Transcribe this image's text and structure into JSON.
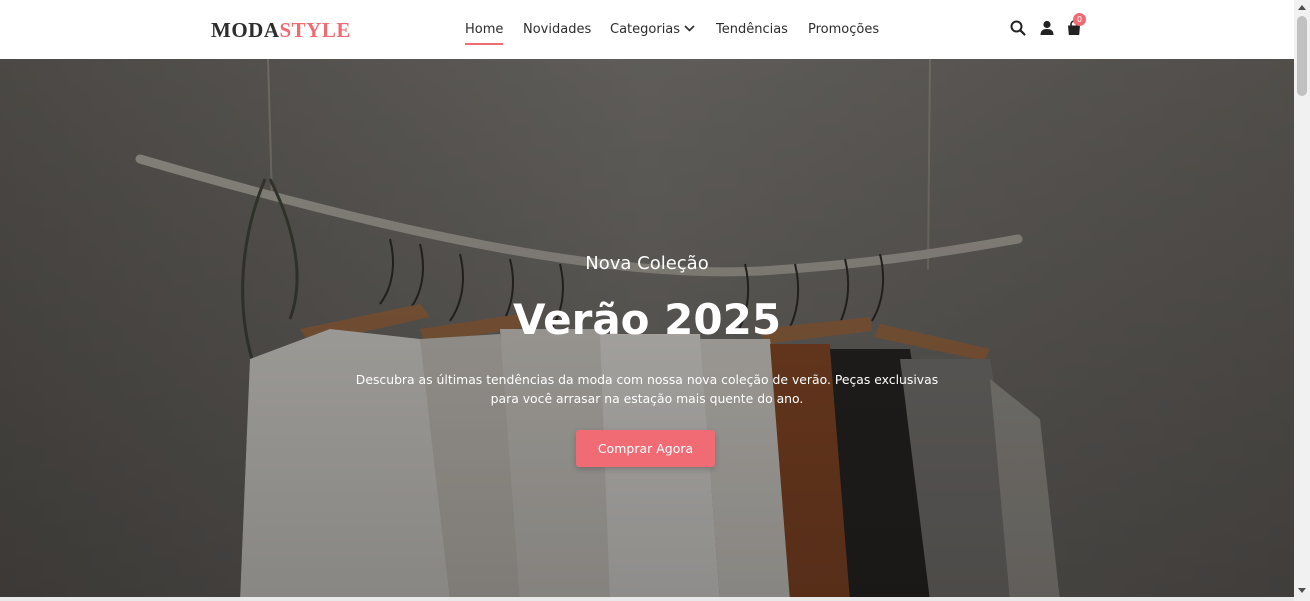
{
  "brand": {
    "part1": "MODA",
    "part2": "STYLE",
    "accent_color": "#f06b74",
    "dark_color": "#2d2d2d"
  },
  "nav": {
    "items": [
      {
        "label": "Home",
        "active": true
      },
      {
        "label": "Novidades",
        "active": false
      },
      {
        "label": "Categorias",
        "active": false,
        "icon": "chevron-down-icon"
      },
      {
        "label": "Tendências",
        "active": false
      },
      {
        "label": "Promoções",
        "active": false
      }
    ]
  },
  "header_icons": {
    "search": "search-icon",
    "user": "user-icon",
    "cart": "shopping-bag-icon"
  },
  "cart": {
    "count": "0"
  },
  "hero": {
    "subtitle": "Nova Coleção",
    "title": "Verão 2025",
    "description": "Descubra as últimas tendências da moda com nossa nova coleção de verão. Peças exclusivas para você arrasar na estação mais quente do ano.",
    "cta_label": "Comprar Agora"
  }
}
